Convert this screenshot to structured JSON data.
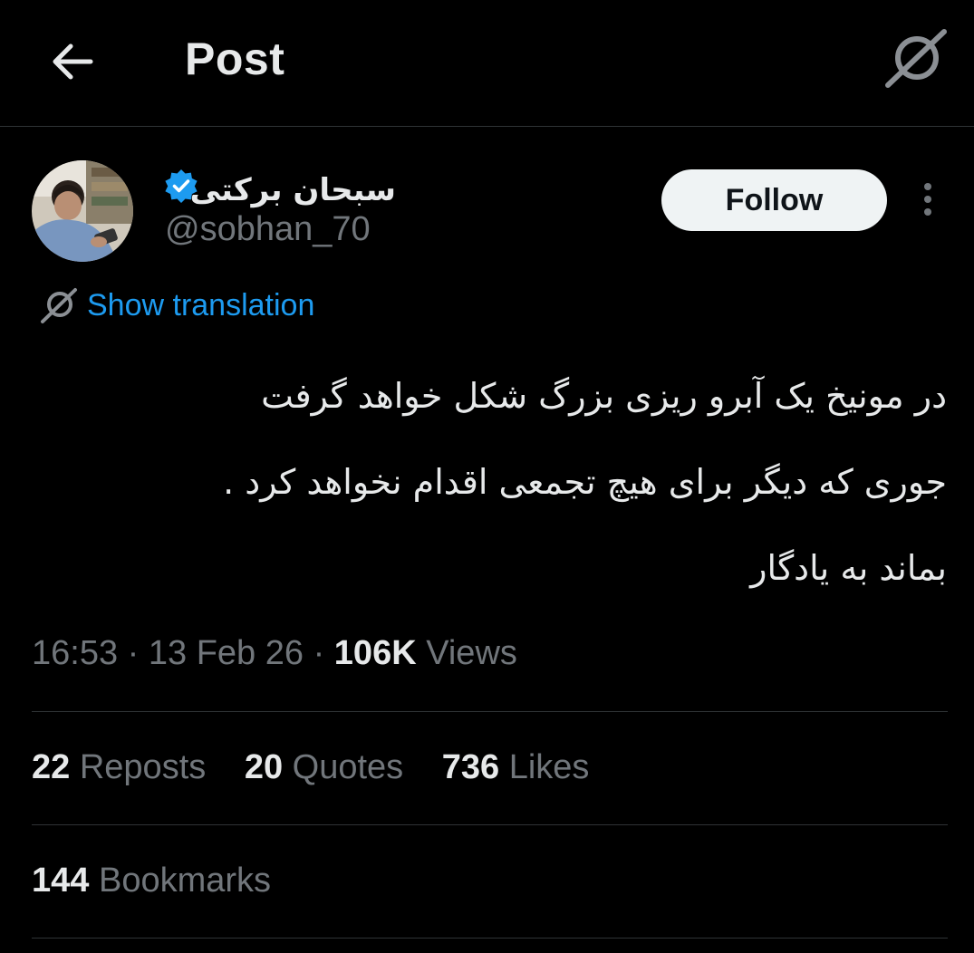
{
  "header": {
    "title": "Post",
    "back_icon": "arrow-left-icon",
    "grok_icon": "grok-icon"
  },
  "author": {
    "name": "سبحان برکتی",
    "handle": "@sobhan_70",
    "verified": true,
    "verified_color": "#1d9bf0",
    "follow_label": "Follow"
  },
  "translation": {
    "label": "Show translation",
    "color": "#1d9bf0"
  },
  "tweet": {
    "lines": [
      "در مونیخ یک آبرو ریزی بزرگ شکل خواهد گرفت",
      "جوری که دیگر برای هیچ تجمعی اقدام نخواهد کرد .",
      "بماند به یادگار"
    ]
  },
  "meta": {
    "time": "16:53",
    "date": "13 Feb 26",
    "views_count": "106K",
    "views_label": "Views",
    "separator": "·"
  },
  "stats": {
    "reposts_count": "22",
    "reposts_label": "Reposts",
    "quotes_count": "20",
    "quotes_label": "Quotes",
    "likes_count": "736",
    "likes_label": "Likes",
    "bookmarks_count": "144",
    "bookmarks_label": "Bookmarks"
  },
  "colors": {
    "background": "#000000",
    "primary_text": "#e7e9ea",
    "secondary_text": "#71767b",
    "divider": "#2f3336",
    "follow_bg": "#eff3f4"
  }
}
